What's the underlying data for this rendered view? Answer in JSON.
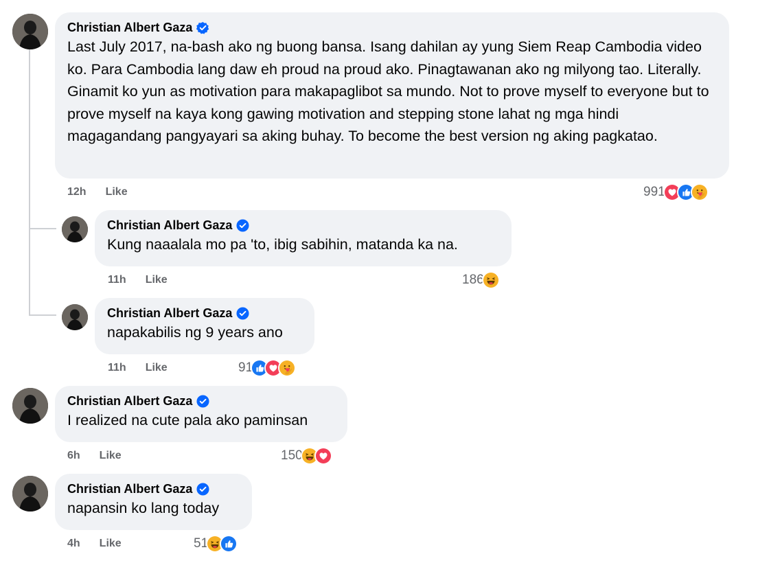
{
  "comments": [
    {
      "author": "Christian Albert Gaza",
      "text": "Last July 2017, na-bash ako ng buong bansa. Isang dahilan ay yung Siem Reap Cambodia video ko. Para Cambodia lang daw eh proud na proud ako. Pinagtawanan ako ng milyong tao. Literally. Ginamit ko yun as motivation para makapaglibot sa mundo. Not to prove myself to everyone but to prove myself na kaya kong gawing motivation and stepping stone lahat ng mga hindi magagandang pangyayari sa aking buhay. To become the best version ng aking pagkatao.",
      "time": "12h",
      "like": "Like",
      "reaction_count": "991",
      "reactions": [
        "love-icon",
        "like-icon",
        "care-icon"
      ]
    },
    {
      "author": "Christian Albert Gaza",
      "text": "Kung naaalala mo pa 'to, ibig sabihin, matanda ka na.",
      "time": "11h",
      "like": "Like",
      "reaction_count": "186",
      "reactions": [
        "haha-icon"
      ]
    },
    {
      "author": "Christian Albert Gaza",
      "text": "napakabilis ng 9 years ano",
      "time": "11h",
      "like": "Like",
      "reaction_count": "91",
      "reactions": [
        "like-icon",
        "love-icon",
        "care-icon"
      ]
    },
    {
      "author": "Christian Albert Gaza",
      "text": "I realized na cute pala ako paminsan",
      "time": "6h",
      "like": "Like",
      "reaction_count": "150",
      "reactions": [
        "haha-icon",
        "love-icon"
      ]
    },
    {
      "author": "Christian Albert Gaza",
      "text": "napansin ko lang today",
      "time": "4h",
      "like": "Like",
      "reaction_count": "51",
      "reactions": [
        "haha-icon",
        "like-icon"
      ]
    }
  ],
  "colors": {
    "bubble": "#f0f2f5",
    "meta": "#65676b",
    "verified": "#0866ff",
    "love": "#f33e58",
    "like": "#1877f2",
    "haha": "#f7b125"
  }
}
